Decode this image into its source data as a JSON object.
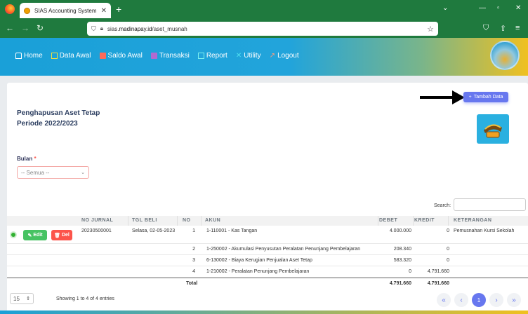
{
  "browser": {
    "tab_title": "SIAS Accounting System",
    "tab_close": "✕",
    "new_tab": "+",
    "url_domain": "madinapay.id",
    "url_prefix": "sias.",
    "url_path": "/aset_musnah",
    "win_min": "—",
    "win_max": "▫",
    "win_close": "✕"
  },
  "menu": {
    "items": [
      {
        "label": "Home",
        "icon": "home-icon",
        "color": "#ffffff"
      },
      {
        "label": "Data Awal",
        "icon": "monitor-icon",
        "color": "#f0e040"
      },
      {
        "label": "Saldo Awal",
        "icon": "wallet-icon",
        "color": "#ff6a5a"
      },
      {
        "label": "Transaksi",
        "icon": "transaction-icon",
        "color": "#b06ad0"
      },
      {
        "label": "Report",
        "icon": "report-icon",
        "color": "#7cf0f0"
      },
      {
        "label": "Utility",
        "icon": "tools-icon",
        "color": "#50e0f0"
      },
      {
        "label": "Logout",
        "icon": "logout-icon",
        "color": "#ff9a7a"
      }
    ]
  },
  "page": {
    "title_line1": "Penghapusan Aset Tetap",
    "title_line2": "Periode 2022/2023",
    "add_button": "Tambah Data",
    "filter_label": "Bulan",
    "filter_required": "*",
    "filter_value": "-- Semua --",
    "search_label": "Search:",
    "search_value": ""
  },
  "table": {
    "headers": [
      "",
      "NO JURNAL",
      "TGL BELI",
      "NO",
      "AKUN",
      "DEBET",
      "KREDIT",
      "KETERANGAN"
    ],
    "edit_label": "Edit",
    "delete_label": "Del",
    "rows": [
      {
        "no_jurnal": "20230500001",
        "tgl_beli": "Selasa, 02-05-2023",
        "no": "1",
        "akun": "1-110001 - Kas Tangan",
        "debet": "4.000.000",
        "kredit": "0",
        "keterangan": "Pemusnahan Kursi Sekolah"
      },
      {
        "no_jurnal": "",
        "tgl_beli": "",
        "no": "2",
        "akun": "1-250002 - Akumulasi Penyusutan Peralatan Penunjang Pembelajaran",
        "debet": "208.340",
        "kredit": "0",
        "keterangan": ""
      },
      {
        "no_jurnal": "",
        "tgl_beli": "",
        "no": "3",
        "akun": "6-130002 - Biaya Kerugian Penjualan Aset Tetap",
        "debet": "583.320",
        "kredit": "0",
        "keterangan": ""
      },
      {
        "no_jurnal": "",
        "tgl_beli": "",
        "no": "4",
        "akun": "1-210002 - Peralatan Penunjang Pembelajaran",
        "debet": "0",
        "kredit": "4.791.660",
        "keterangan": ""
      }
    ],
    "total_label": "Total",
    "total_debet": "4.791.660",
    "total_kredit": "4.791.660"
  },
  "footer": {
    "page_size": "15",
    "info": "Showing 1 to 4 of 4 entries",
    "first": "«",
    "prev": "‹",
    "current": "1",
    "next": "›",
    "last": "»"
  },
  "colors": {
    "accent": "#6777ef",
    "success": "#47c363",
    "danger": "#fc544b"
  }
}
